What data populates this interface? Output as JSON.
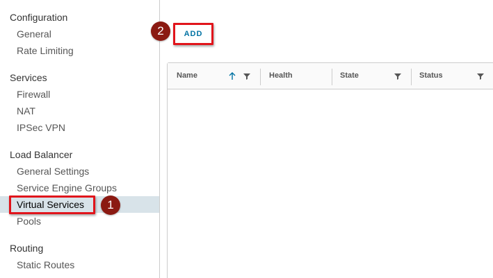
{
  "sidebar": {
    "sections": [
      {
        "title": "Configuration",
        "items": [
          "General",
          "Rate Limiting"
        ]
      },
      {
        "title": "Services",
        "items": [
          "Firewall",
          "NAT",
          "IPSec VPN"
        ]
      },
      {
        "title": "Load Balancer",
        "items": [
          "General Settings",
          "Service Engine Groups",
          "Virtual Services",
          "Pools"
        ]
      },
      {
        "title": "Routing",
        "items": [
          "Static Routes"
        ]
      }
    ],
    "active_item": "Virtual Services"
  },
  "toolbar": {
    "add_label": "ADD"
  },
  "grid": {
    "columns": [
      "Name",
      "Health",
      "State",
      "Status"
    ],
    "sort_column": "Name",
    "sort_direction": "ascending"
  },
  "callouts": {
    "one": "1",
    "two": "2"
  },
  "colors": {
    "highlight": "#e1141b",
    "callout": "#8b1a12",
    "link": "#0072a3",
    "active_bg": "#d8e3e9"
  }
}
